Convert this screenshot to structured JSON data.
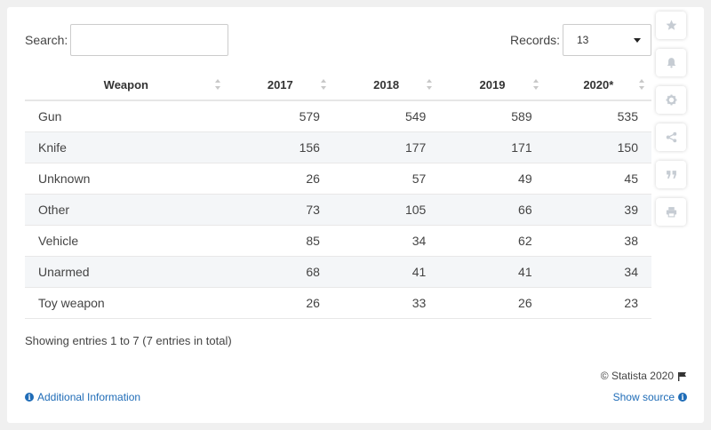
{
  "search": {
    "label": "Search:",
    "value": ""
  },
  "records": {
    "label": "Records:",
    "value": "13"
  },
  "table": {
    "headers": [
      "Weapon",
      "2017",
      "2018",
      "2019",
      "2020*"
    ],
    "rows": [
      [
        "Gun",
        "579",
        "549",
        "589",
        "535"
      ],
      [
        "Knife",
        "156",
        "177",
        "171",
        "150"
      ],
      [
        "Unknown",
        "26",
        "57",
        "49",
        "45"
      ],
      [
        "Other",
        "73",
        "105",
        "66",
        "39"
      ],
      [
        "Vehicle",
        "85",
        "34",
        "62",
        "38"
      ],
      [
        "Unarmed",
        "68",
        "41",
        "41",
        "34"
      ],
      [
        "Toy weapon",
        "26",
        "33",
        "26",
        "23"
      ]
    ]
  },
  "entries_text": "Showing entries 1 to 7 (7 entries in total)",
  "footer": {
    "copyright": "© Statista 2020",
    "additional_info": "Additional Information",
    "show_source": "Show source"
  },
  "sidebar_icons": [
    "star-icon",
    "bell-icon",
    "gear-icon",
    "share-icon",
    "quote-icon",
    "print-icon"
  ],
  "colors": {
    "link": "#1f6cb7",
    "alt_row": "#f4f6f8",
    "icon": "#c6ccd3"
  },
  "chart_data": {
    "type": "table",
    "columns": [
      "Weapon",
      "2017",
      "2018",
      "2019",
      "2020*"
    ],
    "categories": [
      "Gun",
      "Knife",
      "Unknown",
      "Other",
      "Vehicle",
      "Unarmed",
      "Toy weapon"
    ],
    "series": [
      {
        "name": "2017",
        "values": [
          579,
          156,
          26,
          73,
          85,
          68,
          26
        ]
      },
      {
        "name": "2018",
        "values": [
          549,
          177,
          57,
          105,
          34,
          41,
          33
        ]
      },
      {
        "name": "2019",
        "values": [
          589,
          171,
          49,
          66,
          62,
          41,
          26
        ]
      },
      {
        "name": "2020*",
        "values": [
          535,
          150,
          45,
          39,
          38,
          34,
          23
        ]
      }
    ]
  }
}
